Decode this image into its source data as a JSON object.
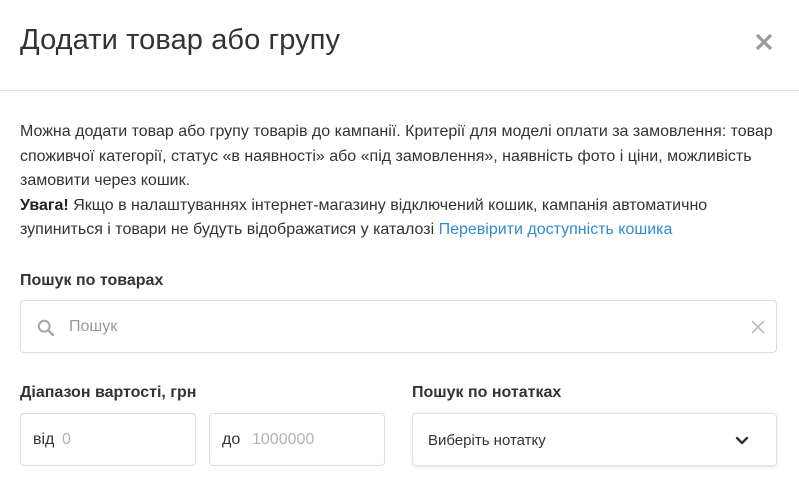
{
  "dialog": {
    "title": "Додати товар або групу",
    "close_icon": "close-icon"
  },
  "description": {
    "text": "Можна додати товар або групу товарів до кампанії. Критерії для моделі оплати за замовлення: товар споживчої категорії, статус «в наявності» або «під замовлення», наявність фото і ціни, можливість замовити через кошик.",
    "warning_label": "Увага!",
    "warning_text": " Якщо в налаштуваннях інтернет-магазину відключений кошик, кампанія автоматично зупиниться і товари не будуть відображатися у каталозі ",
    "link_text": "Перевірити доступність кошика",
    "link_color": "#2f8bd3"
  },
  "product_search": {
    "label": "Пошук по товарах",
    "placeholder": "Пошук",
    "icon": "search-icon",
    "clear_icon": "clear-icon"
  },
  "price_range": {
    "label": "Діапазон вартості, грн",
    "from_prefix": "від",
    "from_placeholder": "0",
    "to_prefix": "до",
    "to_placeholder": "1000000"
  },
  "notes_search": {
    "label": "Пошук по нотатках",
    "selected": "Виберіть нотатку",
    "icon": "chevron-down-icon"
  }
}
